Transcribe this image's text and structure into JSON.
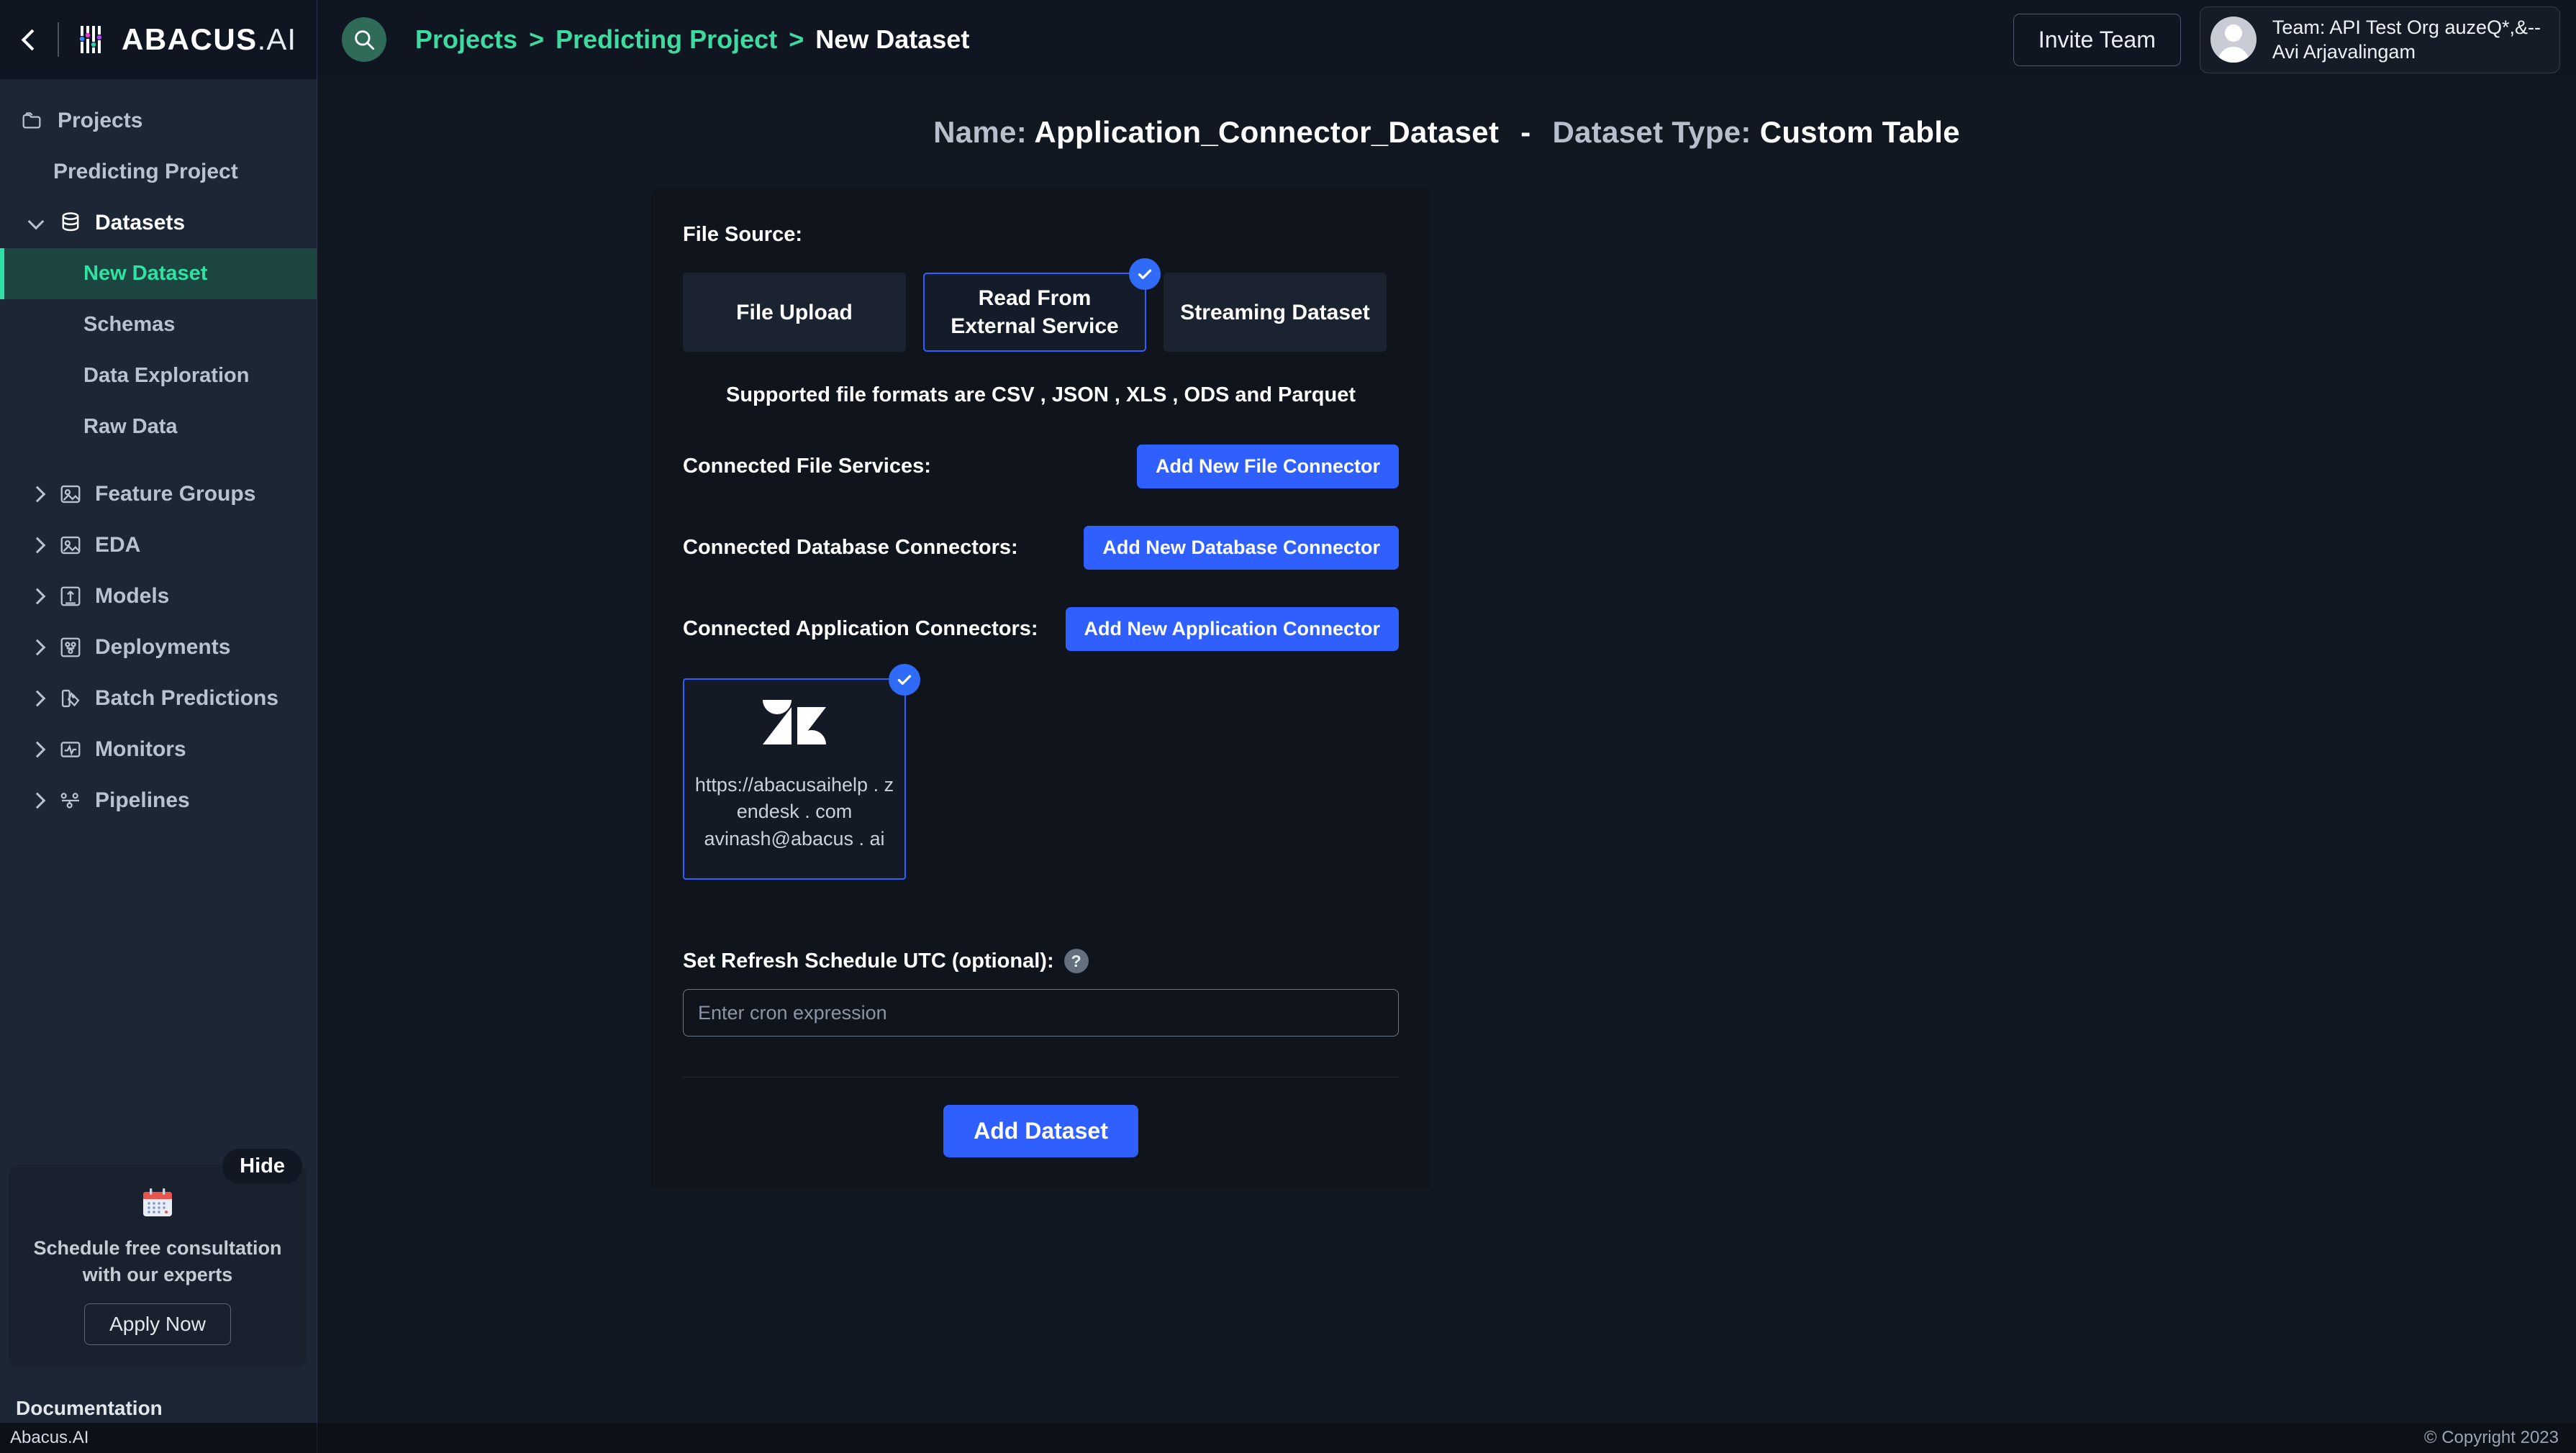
{
  "topbar": {
    "collapse_icon": "chevron-left-icon",
    "brand_bold": "ABACUS",
    "brand_light": ".AI",
    "search_icon": "search-icon",
    "breadcrumb": [
      {
        "label": "Projects",
        "current": false
      },
      {
        "label": "Predicting Project",
        "current": false
      },
      {
        "label": "New Dataset",
        "current": true
      }
    ],
    "separator": ">",
    "invite_label": "Invite Team",
    "team_line1": "Team: API Test Org auzeQ*,&--",
    "team_line2": "Avi Arjavalingam",
    "avatar_icon": "avatar-icon"
  },
  "sidebar": {
    "projects_label": "Projects",
    "projects_icon": "folder-icon",
    "project_name": "Predicting Project",
    "datasets": {
      "label": "Datasets",
      "icon": "database-icon",
      "expanded_icon": "chevron-down-icon",
      "children": [
        {
          "label": "New Dataset",
          "active": true
        },
        {
          "label": "Schemas",
          "active": false
        },
        {
          "label": "Data Exploration",
          "active": false
        },
        {
          "label": "Raw Data",
          "active": false
        }
      ]
    },
    "groups": [
      {
        "label": "Feature Groups",
        "icon": "feature-groups-icon"
      },
      {
        "label": "EDA",
        "icon": "eda-icon"
      },
      {
        "label": "Models",
        "icon": "models-icon"
      },
      {
        "label": "Deployments",
        "icon": "deployments-icon"
      },
      {
        "label": "Batch Predictions",
        "icon": "batch-predictions-icon"
      },
      {
        "label": "Monitors",
        "icon": "monitors-icon"
      },
      {
        "label": "Pipelines",
        "icon": "pipelines-icon"
      }
    ],
    "promo": {
      "hide_label": "Hide",
      "icon": "calendar-icon",
      "text": "Schedule free consultation with our experts",
      "button_label": "Apply Now"
    },
    "documentation_label": "Documentation"
  },
  "main": {
    "title_name_label": "Name:",
    "title_name_value": "Application_Connector_Dataset",
    "title_dash": "-",
    "title_type_label": "Dataset Type:",
    "title_type_value": "Custom Table",
    "file_source_label": "File Source:",
    "tabs": [
      {
        "label": "File Upload",
        "selected": false
      },
      {
        "label": "Read From External Service",
        "selected": true
      },
      {
        "label": "Streaming Dataset",
        "selected": false
      }
    ],
    "formats_note": "Supported file formats are CSV , JSON , XLS , ODS and Parquet",
    "file_services_label": "Connected File Services:",
    "add_file_connector_label": "Add New File Connector",
    "database_connectors_label": "Connected Database Connectors:",
    "add_database_connector_label": "Add New Database Connector",
    "application_connectors_label": "Connected Application Connectors:",
    "add_application_connector_label": "Add New Application Connector",
    "connector": {
      "logo_icon": "zendesk-icon",
      "url": "https://abacusaihelp . zendesk . com",
      "email": "avinash@abacus . ai",
      "selected": true,
      "check_icon": "check-icon"
    },
    "schedule_label": "Set Refresh Schedule UTC (optional):",
    "schedule_help_icon": "help-icon",
    "schedule_help_glyph": "?",
    "cron_placeholder": "Enter cron expression",
    "cron_value": "",
    "add_dataset_label": "Add Dataset"
  },
  "footer": {
    "brand": "Abacus.AI",
    "copyright": "© Copyright 2023"
  },
  "colors": {
    "accent_green": "#2fe2a4",
    "accent_blue": "#2f5fff",
    "sidebar_bg": "#1d2634",
    "page_bg": "#121821",
    "card_bg": "#0f141d"
  }
}
